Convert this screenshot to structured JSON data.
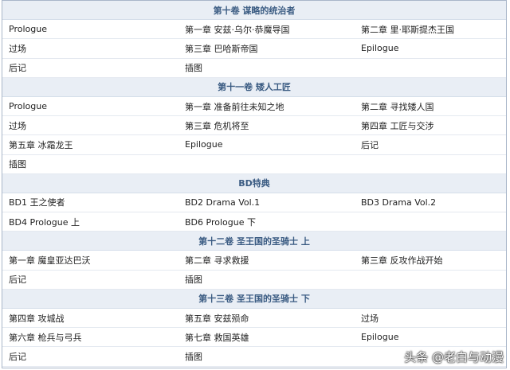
{
  "sections": [
    {
      "title": "第十卷 谋略的统治者",
      "rows": [
        [
          "Prologue",
          "第一章 安兹·乌尔·恭魔导国",
          "第二章 里·耶斯提杰王国"
        ],
        [
          "过场",
          "第三章 巴哈斯帝国",
          "Epilogue"
        ],
        [
          "后记",
          "插图",
          ""
        ]
      ]
    },
    {
      "title": "第十一卷 矮人工匠",
      "rows": [
        [
          "Prologue",
          "第一章 准备前往未知之地",
          "第二章 寻找矮人国"
        ],
        [
          "过场",
          "第三章 危机将至",
          "第四章 工匠与交涉"
        ],
        [
          "第五章 冰霜龙王",
          "Epilogue",
          "后记"
        ],
        [
          "插图",
          "",
          ""
        ]
      ]
    },
    {
      "title": "BD特典",
      "rows": [
        [
          "BD1 王之使者",
          "BD2 Drama Vol.1",
          "BD3 Drama Vol.2"
        ],
        [
          "BD4 Prologue 上",
          "BD6 Prologue 下",
          ""
        ]
      ]
    },
    {
      "title": "第十二卷 圣王国的圣骑士 上",
      "rows": [
        [
          "第一章 魔皇亚达巴沃",
          "第二章 寻求救援",
          "第三章 反攻作战开始"
        ],
        [
          "后记",
          "插图",
          ""
        ]
      ]
    },
    {
      "title": "第十三卷 圣王国的圣骑士 下",
      "rows": [
        [
          "第四章 攻城战",
          "第五章 安兹殒命",
          "过场"
        ],
        [
          "第六章 枪兵与弓兵",
          "第七章 救国英雄",
          "Epilogue"
        ],
        [
          "后记",
          "插图",
          ""
        ]
      ]
    }
  ],
  "watermark": {
    "text": "头条 @老白与动漫",
    "icon": "toutiao-logo-icon"
  }
}
